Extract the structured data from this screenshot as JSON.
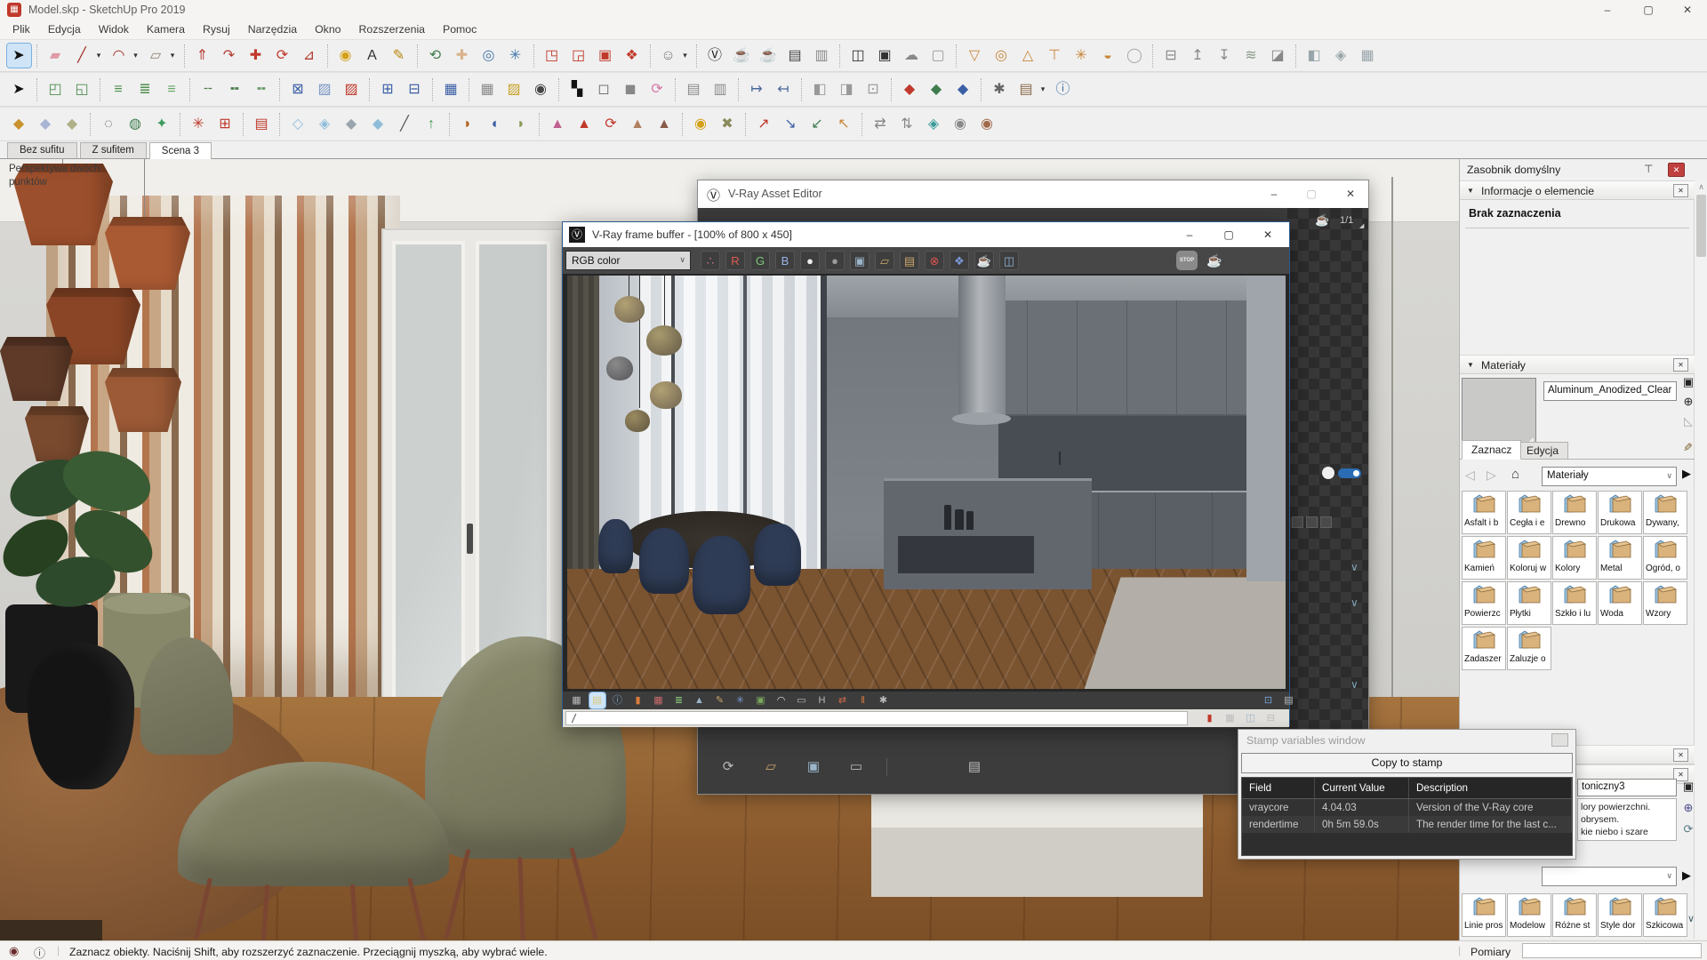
{
  "palette": {
    "accent_selection": "#cfe4f7",
    "vray_orange": "#c9873d",
    "close_red": "#c04040",
    "toolbar_bg": "#f0f0f0",
    "dark_panel": "#3c3c3c",
    "active_border_blue": "#2d5a8a"
  },
  "window": {
    "title": "Model.skp - SketchUp Pro 2019"
  },
  "icons": {
    "sketchup_logo": "▦",
    "minimize": "–",
    "maximize": "▢",
    "close": "✕",
    "pin": "⊤",
    "red_close": "✕",
    "section_collapse": "▼",
    "panel_close": "✕",
    "back": "◁",
    "forward": "▷",
    "home": "⌂",
    "select_arrow": "∨",
    "details": "▶",
    "eyedropper": "✎",
    "display_pane": "▣",
    "create_new": "⊕",
    "sample_swatch": "◺",
    "refresh": "⟳",
    "vray_logo": "Ⓥ",
    "teapot": "☕",
    "counter_corner": "◢",
    "chevron": "∨",
    "geolocation": "◉",
    "info": "ⓘ",
    "scroll_up": "∧",
    "stop_label": "STOP"
  },
  "menu": {
    "items": [
      "Plik",
      "Edycja",
      "Widok",
      "Kamera",
      "Rysuj",
      "Narzędzia",
      "Okno",
      "Rozszerzenia",
      "Pomoc"
    ]
  },
  "toolbars": {
    "row1": [
      {
        "n": "select-tool",
        "g": "➤",
        "c": "#111",
        "hl": 1
      },
      {
        "s": 1
      },
      {
        "n": "eraser-tool",
        "g": "▰",
        "c": "#de9aa6"
      },
      {
        "n": "line-tool",
        "g": "╱",
        "c": "#a03327"
      },
      {
        "n": "line-tool-dropdown",
        "g": "▾",
        "c": "#333",
        "dd": 1
      },
      {
        "n": "arc-tool",
        "g": "◠",
        "c": "#a03327"
      },
      {
        "n": "arc-tool-dropdown",
        "g": "▾",
        "c": "#333",
        "dd": 1
      },
      {
        "n": "rectangle-tool",
        "g": "▱",
        "c": "#8f8471"
      },
      {
        "n": "rectangle-tool-dropdown",
        "g": "▾",
        "c": "#333",
        "dd": 1
      },
      {
        "s": 1
      },
      {
        "n": "push-pull-tool",
        "g": "⇑",
        "c": "#b23b2e"
      },
      {
        "n": "follow-me-tool",
        "g": "↷",
        "c": "#b23b2e"
      },
      {
        "n": "move-tool",
        "g": "✚",
        "c": "#c0392b"
      },
      {
        "n": "rotate-tool",
        "g": "⟳",
        "c": "#c0392b"
      },
      {
        "n": "scale-tool",
        "g": "⊿",
        "c": "#b23b2e"
      },
      {
        "s": 1
      },
      {
        "n": "paint-bucket-tool",
        "g": "◉",
        "c": "#d4a017"
      },
      {
        "n": "text-tool",
        "g": "A",
        "c": "#333"
      },
      {
        "n": "3d-text-tool",
        "g": "✎",
        "c": "#b8860b"
      },
      {
        "s": 1
      },
      {
        "n": "orbit-tool",
        "g": "⟲",
        "c": "#3f7d4f"
      },
      {
        "n": "pan-tool",
        "g": "✚",
        "c": "#d9b38c"
      },
      {
        "n": "zoom-tool",
        "g": "◎",
        "c": "#4477aa"
      },
      {
        "n": "zoom-extents-tool",
        "g": "✳",
        "c": "#4477aa"
      },
      {
        "s": 1
      },
      {
        "n": "section-plane-tool",
        "g": "◳",
        "c": "#c0392b"
      },
      {
        "n": "section-cuts-toggle",
        "g": "◲",
        "c": "#c0392b"
      },
      {
        "n": "section-fill-toggle",
        "g": "▣",
        "c": "#c0392b"
      },
      {
        "n": "geolocation-tool",
        "g": "❖",
        "c": "#c0392b"
      },
      {
        "s": 1
      },
      {
        "n": "user-account-icon",
        "g": "☺",
        "c": "#777"
      },
      {
        "n": "user-account-dropdown",
        "g": "▾",
        "c": "#333",
        "dd": 1
      },
      {
        "s": 1
      },
      {
        "n": "vray-asset-editor-icon",
        "g": "Ⓥ",
        "c": "#222"
      },
      {
        "n": "vray-render-icon",
        "g": "☕",
        "c": "#333"
      },
      {
        "n": "vray-interactive-render-icon",
        "g": "☕",
        "c": "#666"
      },
      {
        "n": "vray-render-last-icon",
        "g": "▤",
        "c": "#444"
      },
      {
        "n": "vray-viewport-render-icon",
        "g": "▥",
        "c": "#888"
      },
      {
        "s": 1
      },
      {
        "n": "vray-frame-buffer-icon",
        "g": "◫",
        "c": "#333"
      },
      {
        "n": "vray-batch-render-icon",
        "g": "▣",
        "c": "#333"
      },
      {
        "n": "vray-cloud-icon",
        "g": "☁",
        "c": "#888"
      },
      {
        "n": "vray-lock-icon",
        "g": "▢",
        "c": "#999"
      },
      {
        "s": 1
      },
      {
        "n": "vray-plane-light-icon",
        "g": "▽",
        "c": "#c9873d"
      },
      {
        "n": "vray-sphere-light-icon",
        "g": "◎",
        "c": "#c9873d"
      },
      {
        "n": "vray-spot-light-icon",
        "g": "△",
        "c": "#c9873d"
      },
      {
        "n": "vray-ies-light-icon",
        "g": "⊤",
        "c": "#c9873d"
      },
      {
        "n": "vray-omni-light-icon",
        "g": "✳",
        "c": "#c9873d"
      },
      {
        "n": "vray-dome-light-icon",
        "g": "◒",
        "c": "#c9873d"
      },
      {
        "n": "vray-mesh-light-icon",
        "g": "◯",
        "c": "#aaa"
      },
      {
        "s": 1
      },
      {
        "n": "vray-infinite-plane-icon",
        "g": "⊟",
        "c": "#888"
      },
      {
        "n": "vray-proxy-export-icon",
        "g": "↥",
        "c": "#888"
      },
      {
        "n": "vray-proxy-import-icon",
        "g": "↧",
        "c": "#888"
      },
      {
        "n": "vray-fur-icon",
        "g": "≋",
        "c": "#889a88"
      },
      {
        "n": "vray-clipper-icon",
        "g": "◪",
        "c": "#888"
      },
      {
        "s": 1
      },
      {
        "n": "vray-decal-icon",
        "g": "◧",
        "c": "#99a5aa"
      },
      {
        "n": "vray-scene-icon",
        "g": "◈",
        "c": "#99a5aa"
      },
      {
        "n": "vray-display-toggle-icon",
        "g": "▦",
        "c": "#99a5aa"
      }
    ],
    "row2": [
      {
        "n": "select-tool-2",
        "g": "➤",
        "c": "#111"
      },
      {
        "s": 1
      },
      {
        "n": "offset-green-icon",
        "g": "◰",
        "c": "#4e8f4e"
      },
      {
        "n": "offset-green-icon-2",
        "g": "◱",
        "c": "#4e8f4e"
      },
      {
        "s": 1
      },
      {
        "n": "edge-lines-icon",
        "g": "≡",
        "c": "#4e8f4e"
      },
      {
        "n": "edge-lines-add-icon",
        "g": "≣",
        "c": "#4e8f4e"
      },
      {
        "n": "edge-lines-remove-icon",
        "g": "≡",
        "c": "#6aa56a"
      },
      {
        "s": 1
      },
      {
        "n": "dash-line-icon",
        "g": "╌",
        "c": "#4e7d4e"
      },
      {
        "n": "dash-line-add-icon",
        "g": "╍",
        "c": "#4e7d4e"
      },
      {
        "n": "dash-line-remove-icon",
        "g": "╍",
        "c": "#6a9a6a"
      },
      {
        "s": 1
      },
      {
        "n": "diagonal-blue-icon",
        "g": "⊠",
        "c": "#3a5fa5"
      },
      {
        "n": "diagonal-light-icon",
        "g": "▨",
        "c": "#7a96c5"
      },
      {
        "n": "diagonal-red-icon",
        "g": "▨",
        "c": "#c0392b"
      },
      {
        "s": 1
      },
      {
        "n": "grid-blue-icon",
        "g": "⊞",
        "c": "#3a5fa5"
      },
      {
        "n": "grid-blue-icon-2",
        "g": "⊟",
        "c": "#3a5fa5"
      },
      {
        "s": 1
      },
      {
        "n": "grid-corner-icon",
        "g": "▦",
        "c": "#3a5fa5"
      },
      {
        "s": 1
      },
      {
        "n": "sandbox-grid-icon",
        "g": "▦",
        "c": "#8a8a8a"
      },
      {
        "n": "sandbox-surface-icon",
        "g": "▨",
        "c": "#c9a227"
      },
      {
        "n": "binoculars-icon",
        "g": "◉",
        "c": "#444"
      },
      {
        "s": 1
      },
      {
        "n": "checkerboard-icon",
        "g": "▚",
        "c": "#111"
      },
      {
        "n": "copy-icon",
        "g": "◻",
        "c": "#666"
      },
      {
        "n": "paste-icon",
        "g": "◼",
        "c": "#888"
      },
      {
        "n": "rotate-pink-icon",
        "g": "⟳",
        "c": "#d678a8"
      },
      {
        "s": 1
      },
      {
        "n": "grid-gray-icon",
        "g": "▤",
        "c": "#8a8a8a"
      },
      {
        "n": "grid-gray-icon-2",
        "g": "▥",
        "c": "#8a8a8a"
      },
      {
        "s": 1
      },
      {
        "n": "dimension-arrow-icon",
        "g": "↦",
        "c": "#4a6a9a"
      },
      {
        "n": "dimension-arrow-icon-2",
        "g": "↤",
        "c": "#4a6a9a"
      },
      {
        "s": 1
      },
      {
        "n": "panel-left-icon",
        "g": "◧",
        "c": "#999"
      },
      {
        "n": "panel-right-icon",
        "g": "◨",
        "c": "#999"
      },
      {
        "n": "panel-center-icon",
        "g": "⊡",
        "c": "#999"
      },
      {
        "s": 1
      },
      {
        "n": "axes-pin-red-icon",
        "g": "◆",
        "c": "#c0392b"
      },
      {
        "n": "axes-pin-green-icon",
        "g": "◆",
        "c": "#3f7d4f"
      },
      {
        "n": "axes-pin-blue-icon",
        "g": "◆",
        "c": "#3a5fa5"
      },
      {
        "s": 1
      },
      {
        "n": "settings-gear-icon",
        "g": "✱",
        "c": "#666"
      },
      {
        "n": "library-icon",
        "g": "▤",
        "c": "#8a6a4a"
      },
      {
        "n": "library-dropdown",
        "g": "▾",
        "c": "#333",
        "dd": 1
      },
      {
        "n": "help-icon",
        "g": "ⓘ",
        "c": "#3a6ea5"
      }
    ],
    "row3": [
      {
        "n": "sphere-gold-icon",
        "g": "◆",
        "c": "#c9922e"
      },
      {
        "n": "sphere-blue-icon",
        "g": "◆",
        "c": "#a8b4d4"
      },
      {
        "n": "sphere-tan-icon",
        "g": "◆",
        "c": "#b0b08a"
      },
      {
        "s": 1
      },
      {
        "n": "stone-tool-icon",
        "g": "◌",
        "c": "#555"
      },
      {
        "n": "bag-tool-icon",
        "g": "◍",
        "c": "#3f7d4f"
      },
      {
        "n": "gem-wire-icon",
        "g": "✦",
        "c": "#3f9d5f"
      },
      {
        "s": 1
      },
      {
        "n": "explode-icon",
        "g": "✳",
        "c": "#c0392b"
      },
      {
        "n": "window-grid-red-icon",
        "g": "⊞",
        "c": "#c0392b"
      },
      {
        "s": 1
      },
      {
        "n": "brick-stack-icon",
        "g": "▤",
        "c": "#c0392b"
      },
      {
        "s": 1
      },
      {
        "n": "glass-cube-icon",
        "g": "◇",
        "c": "#8fbdd9"
      },
      {
        "n": "glass-cube-wire-icon",
        "g": "◈",
        "c": "#8fbdd9"
      },
      {
        "n": "gray-cube-icon",
        "g": "◆",
        "c": "#9aa5ad"
      },
      {
        "n": "glass-shard-icon",
        "g": "◆",
        "c": "#8fbdd9"
      },
      {
        "n": "knife-tool-icon",
        "g": "╱",
        "c": "#555"
      },
      {
        "n": "extrude-up-icon",
        "g": "↑",
        "c": "#3f9d4f"
      },
      {
        "s": 1
      },
      {
        "n": "terrain-tool-icon-1",
        "g": "◗",
        "c": "#b5651d"
      },
      {
        "n": "terrain-tool-icon-2",
        "g": "◖",
        "c": "#3a5fa5"
      },
      {
        "n": "terrain-tool-icon-3",
        "g": "◗",
        "c": "#8a9a5a"
      },
      {
        "s": 1
      },
      {
        "n": "stamp-tool-icon-1",
        "g": "▲",
        "c": "#c06090"
      },
      {
        "n": "stamp-tool-icon-2",
        "g": "▲",
        "c": "#c0392b"
      },
      {
        "n": "stamp-rotate-icon",
        "g": "⟳",
        "c": "#c0392b"
      },
      {
        "n": "stamp-tool-icon-3",
        "g": "▲",
        "c": "#b08060"
      },
      {
        "n": "stamp-flag-icon",
        "g": "▲",
        "c": "#8a5a4a"
      },
      {
        "s": 1
      },
      {
        "n": "color-wheel-icon",
        "g": "◉",
        "c": "#d4a017"
      },
      {
        "n": "toolbox-icon",
        "g": "✖",
        "c": "#8a8a5a"
      },
      {
        "s": 1
      },
      {
        "n": "arrow-tool-red-icon",
        "g": "↗",
        "c": "#c0392b"
      },
      {
        "n": "arrow-tool-blue-icon",
        "g": "↘",
        "c": "#3a5fa5"
      },
      {
        "n": "arrow-tool-green-icon",
        "g": "↙",
        "c": "#3f7d4f"
      },
      {
        "n": "arrow-tool-orange-icon",
        "g": "↖",
        "c": "#c9873d"
      },
      {
        "s": 1
      },
      {
        "n": "swap-icon",
        "g": "⇄",
        "c": "#888"
      },
      {
        "n": "swap-vertical-icon",
        "g": "⇅",
        "c": "#888"
      },
      {
        "n": "teal-shape-icon",
        "g": "◈",
        "c": "#3a9a9a"
      },
      {
        "n": "pin-gray-icon",
        "g": "◉",
        "c": "#8a8a8a"
      },
      {
        "n": "pin-brown-icon",
        "g": "◉",
        "c": "#a06a4a"
      }
    ]
  },
  "scene_tabs": [
    {
      "label": "Bez sufitu"
    },
    {
      "label": "Z sufitem"
    },
    {
      "label": "Scena 3",
      "active": 1
    }
  ],
  "viewport": {
    "overlay": "Perspektywa dwóch punktów"
  },
  "asset_editor": {
    "title": "V-Ray Asset Editor",
    "counter": "1/1",
    "bottom_icons": [
      {
        "n": "asset-update-icon",
        "g": "⟳",
        "c": "#bbb"
      },
      {
        "n": "asset-open-icon",
        "g": "▱",
        "c": "#c9a56a"
      },
      {
        "n": "asset-save-icon",
        "g": "▣",
        "c": "#9ab4c9"
      },
      {
        "n": "asset-delete-icon",
        "g": "▭",
        "c": "#bbb"
      },
      {
        "s": 1
      },
      {
        "sp": 1
      },
      {
        "n": "asset-render-settings-icon",
        "g": "▤",
        "c": "#bbb"
      }
    ]
  },
  "frame_buffer": {
    "title": "V-Ray frame buffer - [100% of 800 x 450]",
    "channel": "RGB color",
    "path_value": "/",
    "toolbar_icons": [
      {
        "n": "rgb-channels-icon",
        "g": "∴",
        "c": "#d9778a"
      },
      {
        "n": "red-channel-button",
        "g": "R",
        "c": "#e05a4f"
      },
      {
        "n": "green-channel-button",
        "g": "G",
        "c": "#7ac97a"
      },
      {
        "n": "blue-channel-button",
        "g": "B",
        "c": "#9ab4e8"
      },
      {
        "n": "white-sphere-icon",
        "g": "●",
        "c": "#eee"
      },
      {
        "n": "gray-sphere-icon",
        "g": "●",
        "c": "#9a9a9a"
      },
      {
        "n": "save-image-icon",
        "g": "▣",
        "c": "#9ab4c9"
      },
      {
        "n": "open-image-icon",
        "g": "▱",
        "c": "#c9a56a"
      },
      {
        "n": "copy-clipboard-icon",
        "g": "▤",
        "c": "#c9a56a"
      },
      {
        "n": "clear-image-icon",
        "g": "⊗",
        "c": "#d9534f"
      },
      {
        "n": "pixel-info-icon",
        "g": "❖",
        "c": "#7a9ad9"
      },
      {
        "n": "render-teapot-icon",
        "g": "☕",
        "c": "#c9873d"
      },
      {
        "n": "vfb-panel-icon",
        "g": "◫",
        "c": "#8ab4d9"
      }
    ],
    "bottom_icons": [
      {
        "n": "vfb-layers-icon",
        "g": "▦",
        "c": "#bbb"
      },
      {
        "n": "vfb-history-icon",
        "g": "▤",
        "c": "#d9c97a",
        "hl": 1
      },
      {
        "n": "vfb-info-icon",
        "g": "ⓘ",
        "c": "#7aa7d9"
      },
      {
        "n": "vfb-exposure-icon",
        "g": "▮",
        "c": "#d97b3d"
      },
      {
        "n": "vfb-hsl-icon",
        "g": "▦",
        "c": "#c96a6a"
      },
      {
        "n": "vfb-color-balance-icon",
        "g": "≣",
        "c": "#8ac97a"
      },
      {
        "n": "vfb-histogram-icon",
        "g": "▲",
        "c": "#9ab4c9"
      },
      {
        "n": "vfb-curves-icon",
        "g": "✎",
        "c": "#c9a56a"
      },
      {
        "n": "vfb-lens-effects-icon",
        "g": "✳",
        "c": "#7a9ad9"
      },
      {
        "n": "vfb-background-icon",
        "g": "▣",
        "c": "#7aa75a"
      },
      {
        "n": "vfb-curve-icon",
        "g": "◠",
        "c": "#ddd"
      },
      {
        "n": "vfb-lut-icon",
        "g": "▭",
        "c": "#bbb"
      },
      {
        "n": "vfb-h-icon",
        "g": "H",
        "c": "#bbb"
      },
      {
        "n": "vfb-compare-icon",
        "g": "⇄",
        "c": "#c96a4a"
      },
      {
        "n": "vfb-stereo-icon",
        "g": "‖",
        "c": "#d97b3d"
      },
      {
        "n": "vfb-denoise-icon",
        "g": "✱",
        "c": "#bbb"
      }
    ],
    "bottom_right_icons": [
      {
        "n": "vfb-screen-icon",
        "g": "⊡",
        "c": "#7aa7d9"
      },
      {
        "n": "vfb-list-icon",
        "g": "▤",
        "c": "#bbb"
      }
    ],
    "path_icons": [
      {
        "n": "vfb-stamp-color-icon",
        "g": "▮",
        "c": "#c0392b"
      },
      {
        "n": "vfb-stamp-icon",
        "g": "▦",
        "c": "#bbb"
      },
      {
        "n": "vfb-monitor-icon",
        "g": "◫",
        "c": "#9ab4c9"
      },
      {
        "n": "vfb-expand-icon",
        "g": "⊟",
        "c": "#bbb"
      }
    ]
  },
  "stamp_window": {
    "title": "Stamp variables window",
    "button": "Copy to stamp",
    "table": {
      "headers": [
        "Field",
        "Current Value",
        "Description"
      ],
      "rows": [
        [
          "vraycore",
          "4.04.03",
          "Version of the V-Ray core"
        ],
        [
          "rendertime",
          "0h  5m 59.0s",
          "The render time for the last c..."
        ]
      ]
    }
  },
  "sidebar": {
    "tray_title": "Zasobnik domyślny",
    "entity_info": {
      "title": "Informacje o elemencie",
      "empty": "Brak zaznaczenia"
    },
    "materials": {
      "title": "Materiały",
      "name": "Aluminum_Anodized_Clear",
      "tabs": [
        "Zaznacz",
        "Edycja"
      ],
      "dropdown": "Materiały",
      "folders": [
        "Asfalt i b",
        "Cegła i e",
        "Drewno",
        "Drukowa",
        "Dywany,",
        "Kamień",
        "Koloruj w",
        "Kolory",
        "Metal",
        "Ogród, o",
        "Powierzc",
        "Płytki",
        "Szkło i lu",
        "Woda",
        "Wzory",
        "Zadaszer",
        "Żaluzje o"
      ]
    },
    "styles": {
      "name": "toniczny3",
      "description_lines": [
        "lory powierzchni.",
        "obrysem.",
        "kie niebo i szare"
      ],
      "folders": [
        "Linie pros",
        "Modelow",
        "Różne st",
        "Style dor",
        "Szkicowa"
      ]
    },
    "measurements_label": "Pomiary"
  },
  "status_bar": {
    "text": "Zaznacz obiekty. Naciśnij Shift, aby rozszerzyć zaznaczenie. Przeciągnij myszką, aby wybrać wiele."
  }
}
